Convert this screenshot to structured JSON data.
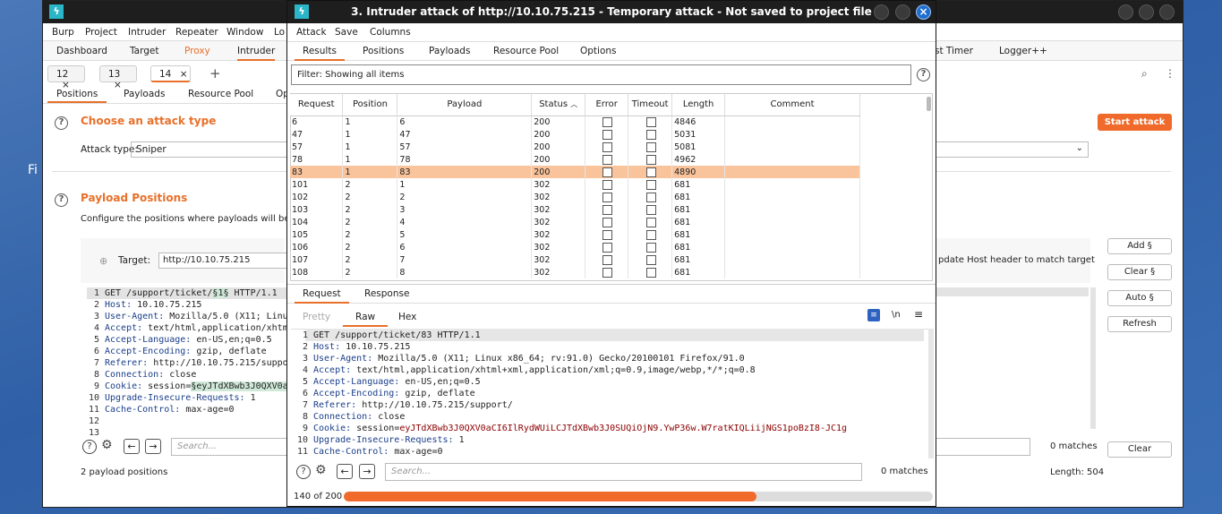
{
  "desktop": {
    "text": "Fi"
  },
  "main": {
    "menu": [
      "Burp",
      "Project",
      "Intruder",
      "Repeater",
      "Window",
      "Lo"
    ],
    "tabs": [
      "Dashboard",
      "Target",
      "Proxy",
      "Intruder",
      "st Timer",
      "Logger++"
    ],
    "req_tabs": [
      "12",
      "13",
      "14"
    ],
    "add_tab": "+",
    "sub_tabs": [
      "Positions",
      "Payloads",
      "Resource Pool",
      "Op"
    ],
    "choose_title": "Choose an attack type",
    "attack_type_label": "Attack type:",
    "attack_type_value": "Sniper",
    "start_attack": "Start attack",
    "positions_title": "Payload Positions",
    "positions_desc": "Configure the positions where payloads will be inse",
    "target_label": "Target:",
    "target_value": "http://10.10.75.215",
    "update_host": "pdate Host header to match target",
    "side_buttons": [
      "Add §",
      "Clear §",
      "Auto §",
      "Refresh"
    ],
    "code": [
      {
        "n": "1",
        "k": "GET /support/ticket/",
        "h": "§1§",
        "r": " HTTP/1.1"
      },
      {
        "n": "2",
        "k": "Host:",
        "v": " 10.10.75.215"
      },
      {
        "n": "3",
        "k": "User-Agent:",
        "v": " Mozilla/5.0 (X11; Linu"
      },
      {
        "n": "4",
        "k": "Accept:",
        "v": " text/html,application/xhtm"
      },
      {
        "n": "5",
        "k": "Accept-Language:",
        "v": " en-US,en;q=0.5"
      },
      {
        "n": "6",
        "k": "Accept-Encoding:",
        "v": " gzip, deflate"
      },
      {
        "n": "7",
        "k": "Referer:",
        "v": " http://10.10.75.215/suppor"
      },
      {
        "n": "8",
        "k": "Connection:",
        "v": " close"
      },
      {
        "n": "9",
        "k": "Cookie:",
        "v": " session=",
        "h": "§eyJTdXBwb3J0QXV0aC"
      },
      {
        "n": "10",
        "k": "Upgrade-Insecure-Requests:",
        "v": " 1"
      },
      {
        "n": "11",
        "k": "Cache-Control:",
        "v": " max-age=0"
      },
      {
        "n": "12",
        "k": "",
        "v": ""
      },
      {
        "n": "13",
        "k": "",
        "v": ""
      }
    ],
    "search_placeholder": "Search...",
    "matches": "0 matches",
    "clear": "Clear",
    "payload_positions": "2 payload positions",
    "length": "Length: 504"
  },
  "attack": {
    "title": "3. Intruder attack of http://10.10.75.215 - Temporary attack - Not saved to project file",
    "menu": [
      "Attack",
      "Save",
      "Columns"
    ],
    "tabs": [
      "Results",
      "Positions",
      "Payloads",
      "Resource Pool",
      "Options"
    ],
    "filter": "Filter: Showing all items",
    "columns": [
      "Request",
      "Position",
      "Payload",
      "Status",
      "Error",
      "Timeout",
      "Length",
      "Comment"
    ],
    "rows": [
      [
        "6",
        "1",
        "6",
        "200",
        "4846"
      ],
      [
        "47",
        "1",
        "47",
        "200",
        "5031"
      ],
      [
        "57",
        "1",
        "57",
        "200",
        "5081"
      ],
      [
        "78",
        "1",
        "78",
        "200",
        "4962"
      ],
      [
        "83",
        "1",
        "83",
        "200",
        "4890"
      ],
      [
        "101",
        "2",
        "1",
        "302",
        "681"
      ],
      [
        "102",
        "2",
        "2",
        "302",
        "681"
      ],
      [
        "103",
        "2",
        "3",
        "302",
        "681"
      ],
      [
        "104",
        "2",
        "4",
        "302",
        "681"
      ],
      [
        "105",
        "2",
        "5",
        "302",
        "681"
      ],
      [
        "106",
        "2",
        "6",
        "302",
        "681"
      ],
      [
        "107",
        "2",
        "7",
        "302",
        "681"
      ],
      [
        "108",
        "2",
        "8",
        "302",
        "681"
      ]
    ],
    "selected_request": "83",
    "rr_tabs": [
      "Request",
      "Response"
    ],
    "view_tabs": [
      "Pretty",
      "Raw",
      "Hex"
    ],
    "newline_toggle": "\\n",
    "code": [
      {
        "n": "1",
        "k": "GET /support/ticket/83 HTTP/1.1",
        "v": ""
      },
      {
        "n": "2",
        "k": "Host:",
        "v": " 10.10.75.215"
      },
      {
        "n": "3",
        "k": "User-Agent:",
        "v": " Mozilla/5.0 (X11; Linux x86_64; rv:91.0) Gecko/20100101 Firefox/91.0"
      },
      {
        "n": "4",
        "k": "Accept:",
        "v": " text/html,application/xhtml+xml,application/xml;q=0.9,image/webp,*/*;q=0.8"
      },
      {
        "n": "5",
        "k": "Accept-Language:",
        "v": " en-US,en;q=0.5"
      },
      {
        "n": "6",
        "k": "Accept-Encoding:",
        "v": " gzip, deflate"
      },
      {
        "n": "7",
        "k": "Referer:",
        "v": " http://10.10.75.215/support/"
      },
      {
        "n": "8",
        "k": "Connection:",
        "v": " close"
      },
      {
        "n": "9",
        "k": "Cookie:",
        "v": " session=",
        "c": "eyJTdXBwb3J0QXV0aCI6IlRydWUiLCJTdXBwb3J0SUQiOjN9.YwP36w.W7ratKIQLiijNGS1poBzI8-JC1g"
      },
      {
        "n": "10",
        "k": "Upgrade-Insecure-Requests:",
        "v": " 1"
      },
      {
        "n": "11",
        "k": "Cache-Control:",
        "v": " max-age=0"
      }
    ],
    "search_placeholder": "Search...",
    "matches": "0 matches",
    "progress_label": "140 of 200",
    "progress_fraction": 0.7
  }
}
